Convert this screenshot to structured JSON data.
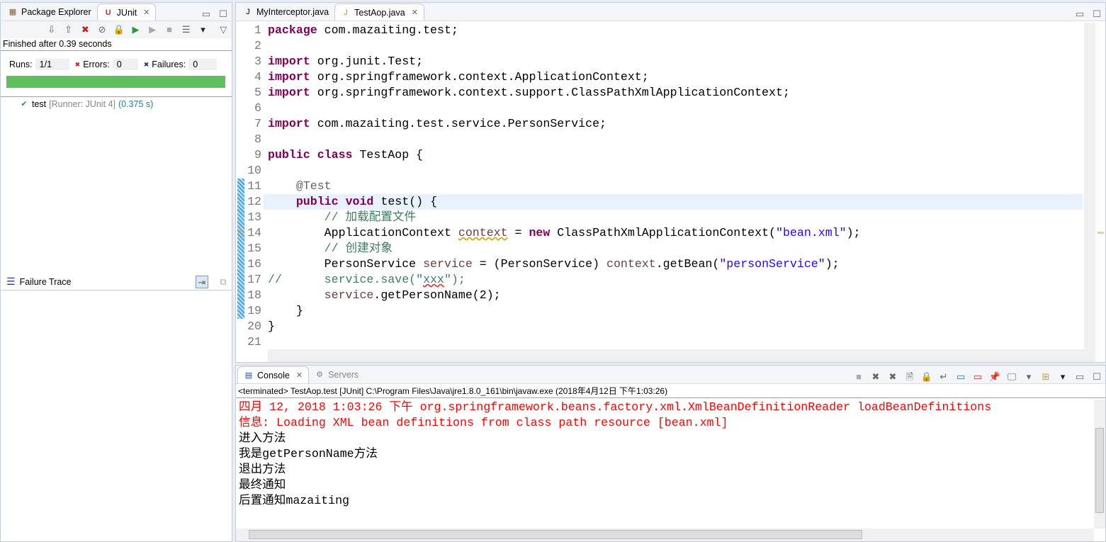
{
  "left": {
    "tabs": [
      {
        "label": "Package Explorer",
        "icon": "package-explorer-icon"
      },
      {
        "label": "JUnit",
        "icon": "junit-icon"
      }
    ],
    "status": "Finished after 0.39 seconds",
    "runs_label": "Runs:",
    "runs_value": "1/1",
    "errors_label": "Errors:",
    "errors_value": "0",
    "failures_label": "Failures:",
    "failures_value": "0",
    "progress": 1.0,
    "progress_color": "#5fbf5f",
    "tree": [
      {
        "name": "test",
        "detail": "[Runner: JUnit 4]",
        "time": "(0.375 s)"
      }
    ],
    "failure_trace_label": "Failure Trace"
  },
  "editor": {
    "tabs": [
      {
        "label": "MyInterceptor.java"
      },
      {
        "label": "TestAop.java",
        "active": true
      }
    ],
    "current_line": 12,
    "lines": [
      [
        [
          "kw",
          "package"
        ],
        [
          "pl",
          " com.mazaiting.test;"
        ]
      ],
      [],
      [
        [
          "kw",
          "import"
        ],
        [
          "pl",
          " org.junit.Test;"
        ]
      ],
      [
        [
          "kw",
          "import"
        ],
        [
          "pl",
          " org.springframework.context.ApplicationContext;"
        ]
      ],
      [
        [
          "kw",
          "import"
        ],
        [
          "pl",
          " org.springframework.context.support.ClassPathXmlApplicationContext;"
        ]
      ],
      [],
      [
        [
          "kw",
          "import"
        ],
        [
          "pl",
          " com.mazaiting.test.service.PersonService;"
        ]
      ],
      [],
      [
        [
          "kw",
          "public"
        ],
        [
          "pl",
          " "
        ],
        [
          "kw",
          "class"
        ],
        [
          "pl",
          " TestAop {"
        ]
      ],
      [],
      [
        [
          "pl",
          "    "
        ],
        [
          "an",
          "@Test"
        ]
      ],
      [
        [
          "pl",
          "    "
        ],
        [
          "kw",
          "public"
        ],
        [
          "pl",
          " "
        ],
        [
          "kw",
          "void"
        ],
        [
          "pl",
          " test() {"
        ]
      ],
      [
        [
          "pl",
          "        "
        ],
        [
          "cm",
          "// 加载配置文件"
        ]
      ],
      [
        [
          "pl",
          "        ApplicationContext "
        ],
        [
          "lv wv",
          "context"
        ],
        [
          "pl",
          " = "
        ],
        [
          "kw",
          "new"
        ],
        [
          "pl",
          " ClassPathXmlApplicationContext("
        ],
        [
          "st",
          "\"bean.xml\""
        ],
        [
          "pl",
          ");"
        ]
      ],
      [
        [
          "pl",
          "        "
        ],
        [
          "cm",
          "// 创建对象"
        ]
      ],
      [
        [
          "pl",
          "        PersonService "
        ],
        [
          "lv",
          "service"
        ],
        [
          "pl",
          " = (PersonService) "
        ],
        [
          "lv",
          "context"
        ],
        [
          "pl",
          ".getBean("
        ],
        [
          "st",
          "\"personService\""
        ],
        [
          "pl",
          ");"
        ]
      ],
      [
        [
          "cm",
          "//      service.save(\""
        ],
        [
          "cm wr",
          "xxx"
        ],
        [
          "cm",
          "\");"
        ]
      ],
      [
        [
          "pl",
          "        "
        ],
        [
          "lv",
          "service"
        ],
        [
          "pl",
          ".getPersonName(2);"
        ]
      ],
      [
        [
          "pl",
          "    }"
        ]
      ],
      [
        [
          "pl",
          "}"
        ]
      ],
      []
    ]
  },
  "console": {
    "tabs": [
      {
        "label": "Console",
        "icon": "console-icon"
      },
      {
        "label": "Servers",
        "icon": "servers-icon"
      }
    ],
    "header": "<terminated> TestAop.test [JUnit] C:\\Program Files\\Java\\jre1.8.0_161\\bin\\javaw.exe (2018年4月12日 下午1:03:26)",
    "lines": [
      {
        "text": "四月 12, 2018 1:03:26 下午 org.springframework.beans.factory.xml.XmlBeanDefinitionReader loadBeanDefinitions",
        "color": "#ff0000"
      },
      {
        "text": "信息: Loading XML bean definitions from class path resource [bean.xml]",
        "color": "#ff0000"
      },
      {
        "text": "进入方法",
        "color": "#000000"
      },
      {
        "text": "我是getPersonName方法",
        "color": "#000000"
      },
      {
        "text": "退出方法",
        "color": "#000000"
      },
      {
        "text": "最终通知",
        "color": "#000000"
      },
      {
        "text": "后置通知mazaiting",
        "color": "#000000"
      }
    ]
  }
}
